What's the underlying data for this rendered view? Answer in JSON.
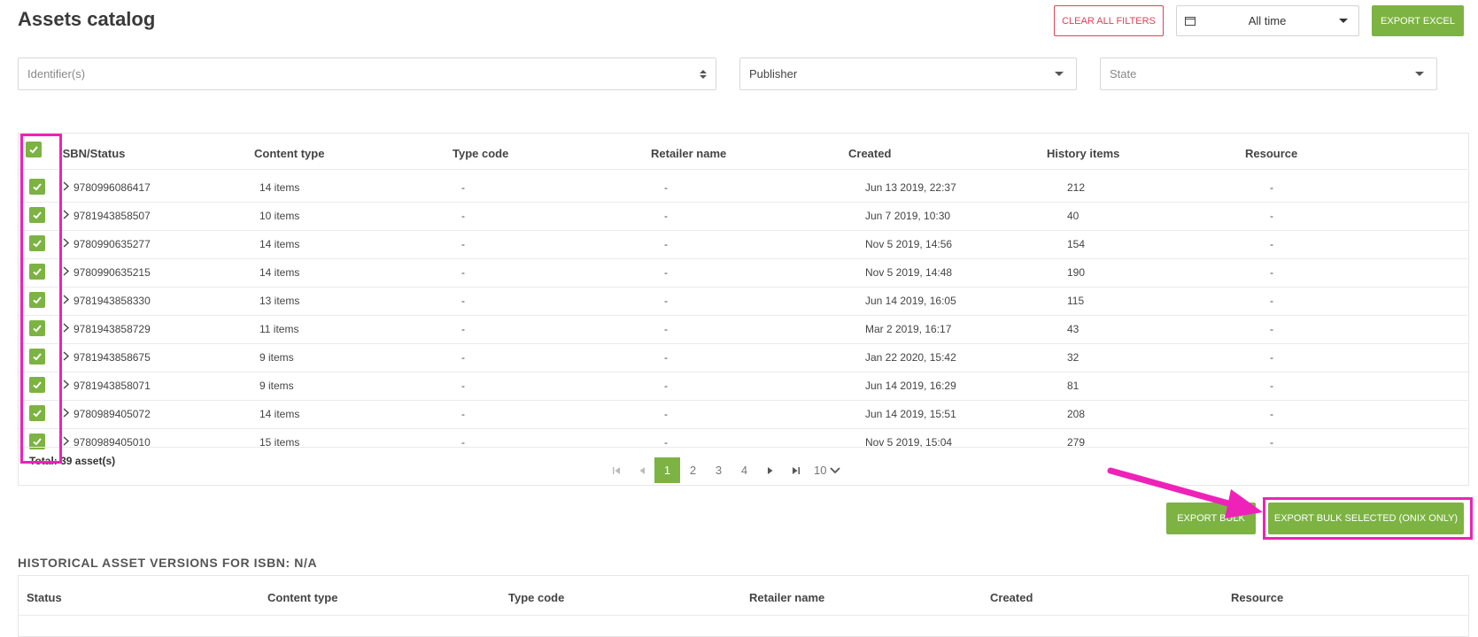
{
  "header": {
    "title": "Assets catalog",
    "clear_filters_label": "CLEAR ALL FILTERS",
    "date_filter": "All time",
    "export_excel_label": "EXPORT EXCEL"
  },
  "filters": {
    "identifier_placeholder": "Identifier(s)",
    "publisher_value": "Publisher",
    "state_placeholder": "State"
  },
  "table": {
    "columns": [
      "ISBN/Status",
      "Content type",
      "Type code",
      "Retailer name",
      "Created",
      "History items",
      "Resource"
    ],
    "rows": [
      {
        "isbn": "9780996086417",
        "content": "14 items",
        "type_code": "-",
        "retailer": "-",
        "created": "Jun 13 2019, 22:37",
        "history": "212",
        "resource": "-"
      },
      {
        "isbn": "9781943858507",
        "content": "10 items",
        "type_code": "-",
        "retailer": "-",
        "created": "Jun 7 2019, 10:30",
        "history": "40",
        "resource": "-"
      },
      {
        "isbn": "9780990635277",
        "content": "14 items",
        "type_code": "-",
        "retailer": "-",
        "created": "Nov 5 2019, 14:56",
        "history": "154",
        "resource": "-"
      },
      {
        "isbn": "9780990635215",
        "content": "14 items",
        "type_code": "-",
        "retailer": "-",
        "created": "Nov 5 2019, 14:48",
        "history": "190",
        "resource": "-"
      },
      {
        "isbn": "9781943858330",
        "content": "13 items",
        "type_code": "-",
        "retailer": "-",
        "created": "Jun 14 2019, 16:05",
        "history": "115",
        "resource": "-"
      },
      {
        "isbn": "9781943858729",
        "content": "11 items",
        "type_code": "-",
        "retailer": "-",
        "created": "Mar 2 2019, 16:17",
        "history": "43",
        "resource": "-"
      },
      {
        "isbn": "9781943858675",
        "content": "9 items",
        "type_code": "-",
        "retailer": "-",
        "created": "Jan 22 2020, 15:42",
        "history": "32",
        "resource": "-"
      },
      {
        "isbn": "9781943858071",
        "content": "9 items",
        "type_code": "-",
        "retailer": "-",
        "created": "Jun 14 2019, 16:29",
        "history": "81",
        "resource": "-"
      },
      {
        "isbn": "9780989405072",
        "content": "14 items",
        "type_code": "-",
        "retailer": "-",
        "created": "Jun 14 2019, 15:51",
        "history": "208",
        "resource": "-"
      },
      {
        "isbn": "9780989405010",
        "content": "15 items",
        "type_code": "-",
        "retailer": "-",
        "created": "Nov 5 2019, 15:04",
        "history": "279",
        "resource": "-"
      }
    ],
    "total": "Total: 39 asset(s)"
  },
  "pagination": {
    "pages": [
      "1",
      "2",
      "3",
      "4"
    ],
    "current": "1",
    "page_size": "10"
  },
  "actions": {
    "export_bulk_label": "EXPORT BULK",
    "export_bulk_selected_label": "EXPORT BULK SELECTED (ONIX ONLY)"
  },
  "history": {
    "title": "HISTORICAL ASSET VERSIONS FOR ISBN: N/A",
    "columns": [
      "Status",
      "Content type",
      "Type code",
      "Retailer name",
      "Created",
      "Resource"
    ]
  },
  "colors": {
    "accent_green": "#7cb342",
    "danger_red": "#e0405a",
    "annotation_magenta": "#ee22b8"
  }
}
